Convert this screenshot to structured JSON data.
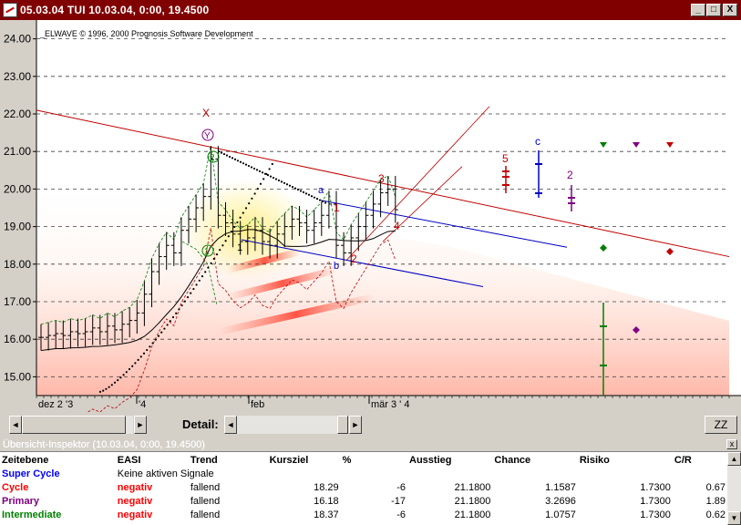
{
  "window": {
    "title": "05.03.04  TUI   10.03.04,  0:00,  19.4500",
    "btn_min": "_",
    "btn_max": "□",
    "btn_close": "X"
  },
  "chart_data": {
    "type": "line",
    "copyright": "_ELWAVE © 1996,  2000  Prognosis  Software  Development",
    "ylim": [
      14.5,
      24.5
    ],
    "yticks": [
      "24.00",
      "23.00",
      "22.00",
      "21.00",
      "20.00",
      "19.00",
      "18.00",
      "17.00",
      "16.00",
      "15.00"
    ],
    "xticks": [
      "dez 2 '3",
      "'4",
      "feb",
      "mär 3 ' 4"
    ],
    "wave_labels": {
      "X": "X",
      "Y": "Y",
      "two": "2",
      "one": "1",
      "one_b": "1",
      "a": "a",
      "b": "b",
      "c": "c",
      "one_red": "1",
      "two_red": "2",
      "three_red": "3",
      "four_red": "4",
      "five_red": "5",
      "two_purple": "2"
    },
    "colors": {
      "red": "#c00000",
      "blue": "#0000c0",
      "green": "#008000",
      "purple": "#800080"
    },
    "series": [
      {
        "name": "",
        "values": [
          16.05,
          16.1,
          16.15,
          16.1,
          16.2,
          16.15,
          16.2,
          16.3,
          16.2,
          16.35,
          16.25,
          16.4,
          16.5,
          16.7,
          17.2,
          17.8,
          18.2,
          18.5,
          18.3,
          18.9,
          19.2,
          19.5,
          19.8,
          20.8,
          19.3,
          19.1,
          18.8,
          18.6,
          18.7,
          18.9,
          18.6,
          18.5,
          18.8,
          19.0,
          19.2,
          19.1,
          18.9,
          19.1,
          19.3,
          19.6,
          18.5,
          18.3,
          18.7,
          19.0,
          19.3,
          19.6,
          19.9,
          20.0,
          19.45
        ]
      }
    ]
  },
  "controls": {
    "detail_label": "Detail:",
    "zz_label": "ZZ",
    "left_arrow": "◄",
    "right_arrow": "►"
  },
  "inspector": {
    "title": "Übersicht-Inspektor (10.03.04, 0:00, 19.4500)",
    "close": "x",
    "headers": [
      "Zeitebene",
      "EASI",
      "Trend",
      "Kursziel",
      "%",
      "Ausstieg",
      "Chance",
      "Risiko",
      "C/R"
    ],
    "rows": [
      {
        "level": "Super Cycle",
        "color": "#0000ff",
        "easi": "Keine aktiven Signale",
        "trend": "",
        "kursziel": "",
        "pct": "",
        "ausstieg": "",
        "chance": "",
        "risiko": "",
        "cr": ""
      },
      {
        "level": "Cycle",
        "color": "#ff0000",
        "easi": "negativ",
        "trend": "fallend",
        "kursziel": "18.29",
        "pct": "-6",
        "ausstieg": "21.1800",
        "chance": "1.1587",
        "risiko": "1.7300",
        "cr": "0.67"
      },
      {
        "level": "Primary",
        "color": "#800080",
        "easi": "negativ",
        "trend": "fallend",
        "kursziel": "16.18",
        "pct": "-17",
        "ausstieg": "21.1800",
        "chance": "3.2696",
        "risiko": "1.7300",
        "cr": "1.89"
      },
      {
        "level": "Intermediate",
        "color": "#008000",
        "easi": "negativ",
        "trend": "fallend",
        "kursziel": "18.37",
        "pct": "-6",
        "ausstieg": "21.1800",
        "chance": "1.0757",
        "risiko": "1.7300",
        "cr": "0.62"
      }
    ]
  }
}
